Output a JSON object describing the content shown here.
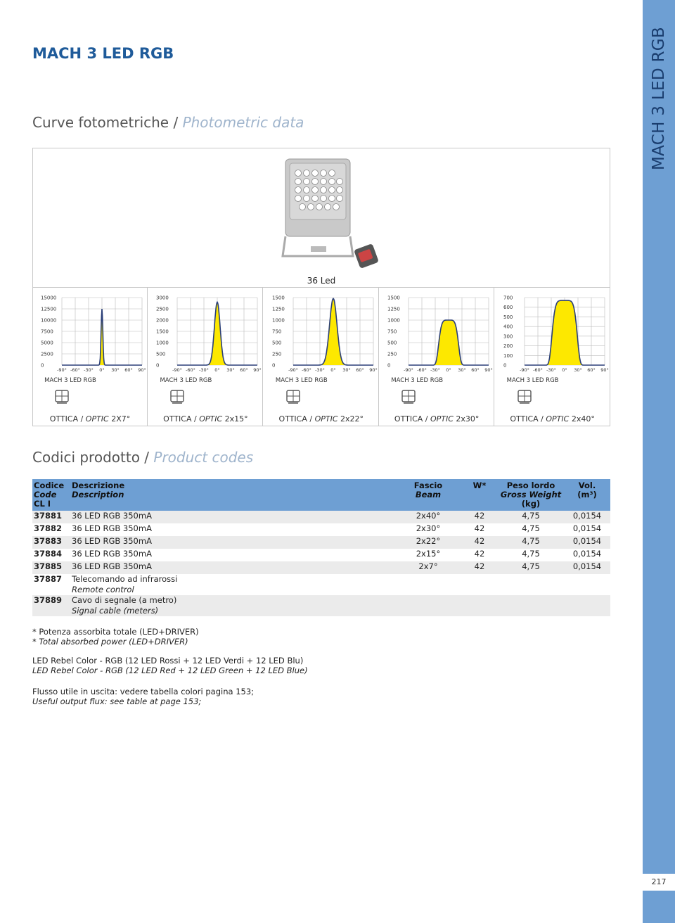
{
  "header": {
    "title": "MACH 3 LED RGB"
  },
  "sidebar": {
    "title": "MACH 3 LED RGB",
    "page_number": "217"
  },
  "photometric": {
    "title_it": "Curve fotometriche / ",
    "title_en": "Photometric data",
    "product_label": "36 Led",
    "charts": [
      {
        "name": "MACH 3 LED RGB",
        "optic_prefix": "OTTICA / ",
        "optic_it": "OPTIC",
        "optic_value": " 2X7°",
        "yticks": [
          "15000",
          "12500",
          "10000",
          "7500",
          "5000",
          "2500",
          "0"
        ],
        "ymax": 15000,
        "half_width_deg": 3
      },
      {
        "name": "MACH 3 LED RGB",
        "optic_prefix": "OTTICA / ",
        "optic_it": "OPTIC",
        "optic_value": " 2x15°",
        "yticks": [
          "3000",
          "2500",
          "2000",
          "1500",
          "1000",
          "500",
          "0"
        ],
        "ymax": 3000,
        "half_width_deg": 10
      },
      {
        "name": "MACH 3 LED RGB",
        "optic_prefix": "OTTICA / ",
        "optic_it": "OPTIC",
        "optic_value": " 2x22°",
        "yticks": [
          "1500",
          "1250",
          "1000",
          "750",
          "500",
          "250",
          "0"
        ],
        "ymax": 1500,
        "half_width_deg": 13
      },
      {
        "name": "MACH 3 LED RGB",
        "optic_prefix": "OTTICA / ",
        "optic_it": "OPTIC",
        "optic_value": " 2x30°",
        "yticks": [
          "1500",
          "1250",
          "1000",
          "750",
          "500",
          "250",
          "0"
        ],
        "ymax": 1500,
        "half_width_deg": 22
      },
      {
        "name": "MACH 3 LED RGB",
        "optic_prefix": "OTTICA / ",
        "optic_it": "OPTIC",
        "optic_value": " 2x40°",
        "yticks": [
          "700",
          "600",
          "500",
          "400",
          "300",
          "200",
          "100",
          "0"
        ],
        "ymax": 700,
        "half_width_deg": 28
      }
    ],
    "xticks": [
      "-90°",
      "-60°",
      "-30°",
      "0°",
      "30°",
      "60°",
      "90°"
    ]
  },
  "chart_data": [
    {
      "type": "line",
      "xlabel": "",
      "ylabel": "",
      "x": [
        -90,
        -60,
        -30,
        0,
        30,
        60,
        90
      ],
      "ylim": [
        0,
        15000
      ],
      "peak": {
        "x": 0,
        "y": 12500
      }
    },
    {
      "type": "line",
      "xlabel": "",
      "ylabel": "",
      "x": [
        -90,
        -60,
        -30,
        0,
        30,
        60,
        90
      ],
      "ylim": [
        0,
        3000
      ],
      "peak": {
        "x": 0,
        "y": 2800
      }
    },
    {
      "type": "line",
      "xlabel": "",
      "ylabel": "",
      "x": [
        -90,
        -60,
        -30,
        0,
        30,
        60,
        90
      ],
      "ylim": [
        0,
        1500
      ],
      "peak": {
        "x": 0,
        "y": 1480
      }
    },
    {
      "type": "line",
      "xlabel": "",
      "ylabel": "",
      "x": [
        -90,
        -60,
        -30,
        0,
        30,
        60,
        90
      ],
      "ylim": [
        0,
        1500
      ],
      "peak": {
        "x": 0,
        "y": 1000
      }
    },
    {
      "type": "line",
      "xlabel": "",
      "ylabel": "",
      "x": [
        -90,
        -60,
        -30,
        0,
        30,
        60,
        90
      ],
      "ylim": [
        0,
        700
      ],
      "peak": {
        "x": 0,
        "y": 670
      }
    }
  ],
  "codes": {
    "title_it": "Codici prodotto / ",
    "title_en": "Product codes",
    "headers": {
      "code_it": "Codice",
      "code_en": "Code",
      "code_cl": "CL I",
      "desc_it": "Descrizione",
      "desc_en": "Description",
      "beam_it": "Fascio",
      "beam_en": "Beam",
      "watt": "W*",
      "weight_it": "Peso lordo",
      "weight_en": "Gross Weight",
      "weight_unit": "(kg)",
      "vol": "Vol.",
      "vol_unit": "(m³)"
    },
    "rows": [
      {
        "code": "37881",
        "desc": "36 LED RGB 350mA",
        "desc_en": "",
        "beam": "2x40°",
        "watt": "42",
        "weight": "4,75",
        "vol": "0,0154"
      },
      {
        "code": "37882",
        "desc": "36 LED RGB 350mA",
        "desc_en": "",
        "beam": "2x30°",
        "watt": "42",
        "weight": "4,75",
        "vol": "0,0154"
      },
      {
        "code": "37883",
        "desc": "36 LED RGB 350mA",
        "desc_en": "",
        "beam": "2x22°",
        "watt": "42",
        "weight": "4,75",
        "vol": "0,0154"
      },
      {
        "code": "37884",
        "desc": "36 LED RGB 350mA",
        "desc_en": "",
        "beam": "2x15°",
        "watt": "42",
        "weight": "4,75",
        "vol": "0,0154"
      },
      {
        "code": "37885",
        "desc": "36 LED RGB 350mA",
        "desc_en": "",
        "beam": "2x7°",
        "watt": "42",
        "weight": "4,75",
        "vol": "0,0154"
      },
      {
        "code": "37887",
        "desc": "Telecomando ad infrarossi",
        "desc_en": "Remote control",
        "beam": "",
        "watt": "",
        "weight": "",
        "vol": ""
      },
      {
        "code": "37889",
        "desc": "Cavo di segnale (a metro)",
        "desc_en": "Signal cable (meters)",
        "beam": "",
        "watt": "",
        "weight": "",
        "vol": ""
      }
    ]
  },
  "notes": {
    "power_it": "* Potenza assorbita totale (LED+DRIVER)",
    "power_en": "* Total absorbed power (LED+DRIVER)",
    "led_it": "LED Rebel Color - RGB (12 LED Rossi + 12 LED Verdi + 12 LED Blu)",
    "led_en": "LED Rebel Color - RGB (12 LED Red + 12 LED Green + 12 LED Blue)",
    "flux_it": "Flusso utile in uscita: vedere tabella colori pagina 153;",
    "flux_en": "Useful output flux: see table at page 153;"
  },
  "colors": {
    "accent": "#6e9fd3",
    "title": "#1f5b9a",
    "curve_fill": "#fde800",
    "curve_line": "#2b3f78"
  }
}
